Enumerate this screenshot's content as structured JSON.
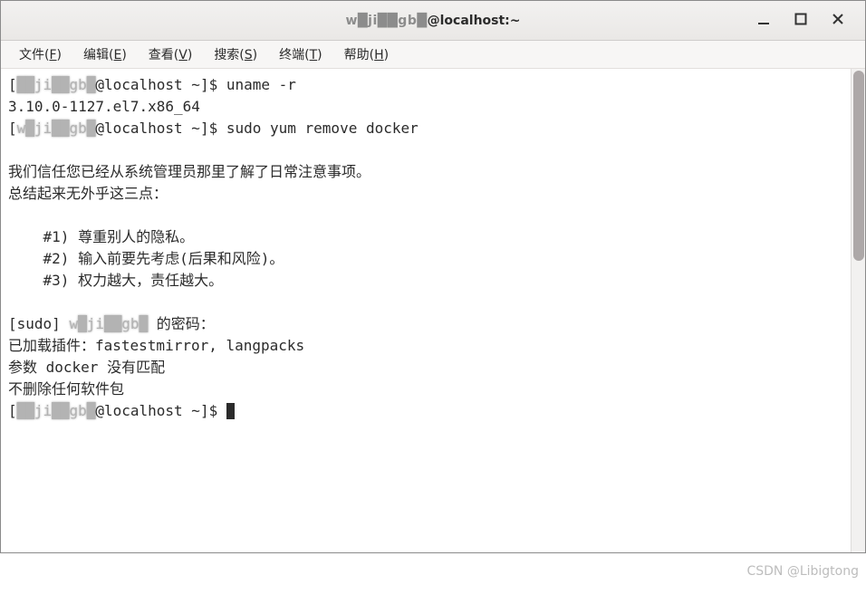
{
  "titlebar": {
    "user_obscured": "w█ji██gb█",
    "at": "@",
    "host": "localhost:~"
  },
  "menu": {
    "file": {
      "label": "文件(",
      "accel": "F",
      "close": ")"
    },
    "edit": {
      "label": "编辑(",
      "accel": "E",
      "close": ")"
    },
    "view": {
      "label": "查看(",
      "accel": "V",
      "close": ")"
    },
    "search": {
      "label": "搜索(",
      "accel": "S",
      "close": ")"
    },
    "terminal": {
      "label": "终端(",
      "accel": "T",
      "close": ")"
    },
    "help": {
      "label": "帮助(",
      "accel": "H",
      "close": ")"
    }
  },
  "terminal": {
    "lines": {
      "l1_a": "[",
      "l1_user": "██ji██gb█",
      "l1_b": "@localhost ~]$ uname -r",
      "l2": "3.10.0-1127.el7.x86_64",
      "l3_a": "[",
      "l3_user": "w█ji██gb█",
      "l3_b": "@localhost ~]$ sudo yum remove docker",
      "l4": "",
      "l5": "我们信任您已经从系统管理员那里了解了日常注意事项。",
      "l6": "总结起来无外乎这三点：",
      "l7": "",
      "l8": "    #1) 尊重别人的隐私。",
      "l9": "    #2) 输入前要先考虑(后果和风险)。",
      "l10": "    #3) 权力越大，责任越大。",
      "l11": "",
      "l12_a": "[sudo] ",
      "l12_user": "w█ji██gb█",
      "l12_b": " 的密码：",
      "l13": "已加载插件：fastestmirror, langpacks",
      "l14": "参数 docker 没有匹配",
      "l15": "不删除任何软件包",
      "l16_a": "[",
      "l16_user": "██ji██gb█",
      "l16_b": "@localhost ~]$ "
    }
  },
  "watermark": "CSDN @Libigtong"
}
